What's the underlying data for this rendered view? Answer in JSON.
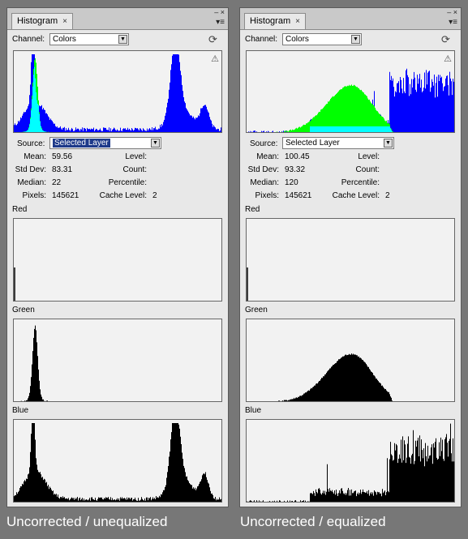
{
  "panels": [
    {
      "tab_title": "Histogram",
      "close_glyph": "×",
      "menu_glyph": "▾≡",
      "winctl": "– ×",
      "channel_label": "Channel:",
      "channel_value": "Colors",
      "source_label": "Source:",
      "source_value": "Selected Layer",
      "stats": {
        "mean_label": "Mean:",
        "mean": "59.56",
        "stddev_label": "Std Dev:",
        "stddev": "83.31",
        "median_label": "Median:",
        "median": "22",
        "pixels_label": "Pixels:",
        "pixels": "145621",
        "level_label": "Level:",
        "level": "",
        "count_label": "Count:",
        "count": "",
        "percentile_label": "Percentile:",
        "percentile": "",
        "cache_label": "Cache Level:",
        "cache": "2"
      },
      "red_label": "Red",
      "green_label": "Green",
      "blue_label": "Blue",
      "caption": "Uncorrected / unequalized",
      "histograms": {
        "green_peak": {
          "center": 0.1,
          "width": 0.012,
          "height": 0.9
        },
        "blue_peaks": [
          0.09,
          0.77,
          0.9
        ]
      }
    },
    {
      "tab_title": "Histogram",
      "close_glyph": "×",
      "menu_glyph": "▾≡",
      "winctl": "– ×",
      "channel_label": "Channel:",
      "channel_value": "Colors",
      "source_label": "Source:",
      "source_value": "Selected Layer",
      "stats": {
        "mean_label": "Mean:",
        "mean": "100.45",
        "stddev_label": "Std Dev:",
        "stddev": "93.32",
        "median_label": "Median:",
        "median": "120",
        "pixels_label": "Pixels:",
        "pixels": "145621",
        "level_label": "Level:",
        "level": "",
        "count_label": "Count:",
        "count": "",
        "percentile_label": "Percentile:",
        "percentile": "",
        "cache_label": "Cache Level:",
        "cache": "2"
      },
      "red_label": "Red",
      "green_label": "Green",
      "blue_label": "Blue",
      "caption": "Uncorrected / equalized",
      "histograms": {
        "green_peak": {
          "center": 0.58,
          "width": 0.12,
          "height": 0.6
        },
        "blue_peaks": [
          0.35,
          0.75,
          1.0
        ]
      }
    }
  ],
  "colors": {
    "composite_green": "#00ff00",
    "composite_blue": "#0000ff",
    "composite_cyan": "#00ffff",
    "channel_black": "#000000",
    "red_baseline": "#ffff00"
  }
}
